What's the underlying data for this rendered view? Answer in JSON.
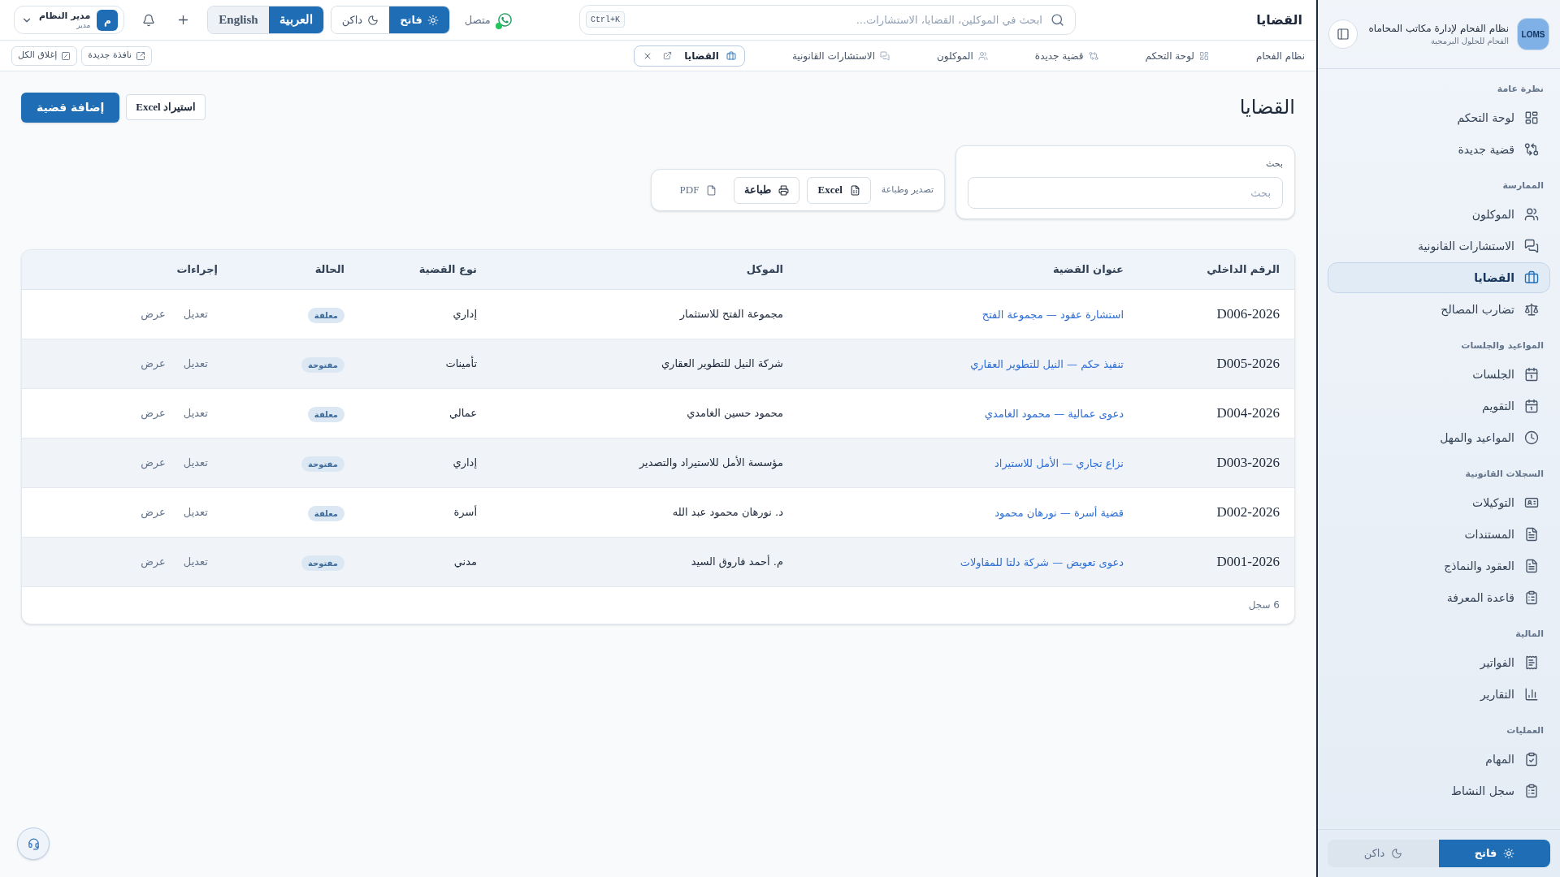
{
  "sidebar": {
    "logo_text": "LOMS",
    "title": "نظام الفحام لإدارة مكاتب المحاماه",
    "subtitle": "الفحام للحلول البرمجية",
    "sections": [
      {
        "label": "نظرة عامة",
        "items": [
          {
            "label": "لوحة التحكم",
            "selected": false
          },
          {
            "label": "قضية جديدة",
            "selected": false
          }
        ]
      },
      {
        "label": "الممارسة",
        "items": [
          {
            "label": "الموكلون",
            "selected": false
          },
          {
            "label": "الاستشارات القانونية",
            "selected": false
          },
          {
            "label": "القضايا",
            "selected": true
          },
          {
            "label": "تضارب المصالح",
            "selected": false
          }
        ]
      },
      {
        "label": "المواعيد والجلسات",
        "items": [
          {
            "label": "الجلسات",
            "selected": false
          },
          {
            "label": "التقويم",
            "selected": false
          },
          {
            "label": "المواعيد والمهل",
            "selected": false
          }
        ]
      },
      {
        "label": "السجلات القانونية",
        "items": [
          {
            "label": "التوكيلات",
            "selected": false
          },
          {
            "label": "المستندات",
            "selected": false
          },
          {
            "label": "العقود والنماذج",
            "selected": false
          },
          {
            "label": "قاعدة المعرفة",
            "selected": false
          }
        ]
      },
      {
        "label": "المالية",
        "items": [
          {
            "label": "الفواتير",
            "selected": false
          },
          {
            "label": "التقارير",
            "selected": false
          }
        ]
      },
      {
        "label": "العمليات",
        "items": [
          {
            "label": "المهام",
            "selected": false
          },
          {
            "label": "سجل النشاط",
            "selected": false
          }
        ]
      }
    ],
    "theme_toggle": [
      {
        "label": "فاتح",
        "selected": true
      },
      {
        "label": "داكن",
        "selected": false
      }
    ]
  },
  "header": {
    "title": "القضايا",
    "search": {
      "placeholder": "ابحث في الموكلين، القضايا، الاستشارات...",
      "shortcut": "Ctrl+K"
    },
    "connection": {
      "label": "متصل",
      "online": true
    },
    "theme_toggle": [
      {
        "label": "فاتح",
        "selected": true
      },
      {
        "label": "داكن",
        "selected": false
      }
    ],
    "language_toggle": [
      {
        "label": "العربية",
        "selected": true
      },
      {
        "label": "English",
        "selected": false
      }
    ],
    "user": {
      "initial": "م",
      "name": "مدير النظام",
      "role": "مدير"
    }
  },
  "tab_bar": {
    "quick_links": [
      "نظام الفحام",
      "لوحة التحكم",
      "قضية جديدة",
      "الموكلون",
      "الاستشارات القانونية"
    ],
    "open_tabs": [
      {
        "label": "القضايا",
        "selected": true
      }
    ],
    "actions": [
      "نافذة جديدة",
      "إغلاق الكل"
    ]
  },
  "page": {
    "title": "القضايا",
    "buttons": [
      {
        "label": "استيراد Excel",
        "kind": "outline"
      },
      {
        "label": "إضافة قضية",
        "kind": "primary"
      }
    ],
    "search": {
      "label": "بحث",
      "placeholder": "بحث"
    },
    "export": {
      "label": "تصدير وطباعة",
      "buttons": [
        {
          "label": "Excel",
          "kind": "outline"
        },
        {
          "label": "طباعة",
          "kind": "outline"
        },
        {
          "label": "PDF",
          "kind": "ghost"
        }
      ]
    }
  },
  "table": {
    "columns": [
      "الرقم الداخلي",
      "عنوان القضية",
      "الموكل",
      "نوع القضية",
      "الحالة",
      "إجراءات"
    ],
    "rows": [
      {
        "id": "D006-2026",
        "title": "استشارة عقود — مجموعة الفتح",
        "client": "مجموعة الفتح للاستثمار",
        "type": "إداري",
        "status": "معلقة",
        "actions": [
          "تعديل",
          "عرض"
        ]
      },
      {
        "id": "D005-2026",
        "title": "تنفيذ حكم — النيل للتطوير العقاري",
        "client": "شركة النيل للتطوير العقاري",
        "type": "تأمينات",
        "status": "مفتوحة",
        "actions": [
          "تعديل",
          "عرض"
        ]
      },
      {
        "id": "D004-2026",
        "title": "دعوى عمالية — محمود الغامدي",
        "client": "محمود حسين الغامدي",
        "type": "عمالي",
        "status": "معلقة",
        "actions": [
          "تعديل",
          "عرض"
        ]
      },
      {
        "id": "D003-2026",
        "title": "نزاع تجاري — الأمل للاستيراد",
        "client": "مؤسسة الأمل للاستيراد والتصدير",
        "type": "إداري",
        "status": "مفتوحة",
        "actions": [
          "تعديل",
          "عرض"
        ]
      },
      {
        "id": "D002-2026",
        "title": "قضية أسرة — نورهان محمود",
        "client": "د. نورهان محمود عبد الله",
        "type": "أسرة",
        "status": "معلقة",
        "actions": [
          "تعديل",
          "عرض"
        ]
      },
      {
        "id": "D001-2026",
        "title": "دعوى تعويض — شركة دلتا للمقاولات",
        "client": "م. أحمد فاروق السيد",
        "type": "مدني",
        "status": "مفتوحة",
        "actions": [
          "تعديل",
          "عرض"
        ]
      }
    ],
    "footer": "6 سجل"
  }
}
